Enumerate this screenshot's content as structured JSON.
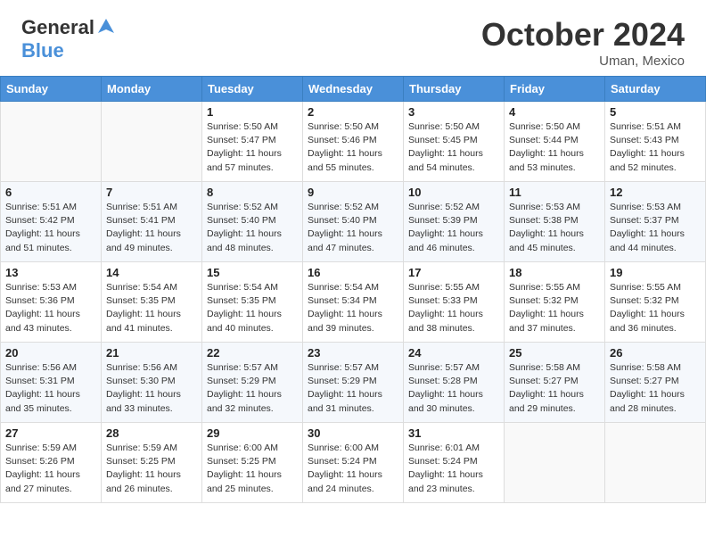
{
  "header": {
    "logo_line1": "General",
    "logo_line2": "Blue",
    "month": "October 2024",
    "location": "Uman, Mexico"
  },
  "weekdays": [
    "Sunday",
    "Monday",
    "Tuesday",
    "Wednesday",
    "Thursday",
    "Friday",
    "Saturday"
  ],
  "weeks": [
    [
      {
        "day": "",
        "info": ""
      },
      {
        "day": "",
        "info": ""
      },
      {
        "day": "1",
        "info": "Sunrise: 5:50 AM\nSunset: 5:47 PM\nDaylight: 11 hours and 57 minutes."
      },
      {
        "day": "2",
        "info": "Sunrise: 5:50 AM\nSunset: 5:46 PM\nDaylight: 11 hours and 55 minutes."
      },
      {
        "day": "3",
        "info": "Sunrise: 5:50 AM\nSunset: 5:45 PM\nDaylight: 11 hours and 54 minutes."
      },
      {
        "day": "4",
        "info": "Sunrise: 5:50 AM\nSunset: 5:44 PM\nDaylight: 11 hours and 53 minutes."
      },
      {
        "day": "5",
        "info": "Sunrise: 5:51 AM\nSunset: 5:43 PM\nDaylight: 11 hours and 52 minutes."
      }
    ],
    [
      {
        "day": "6",
        "info": "Sunrise: 5:51 AM\nSunset: 5:42 PM\nDaylight: 11 hours and 51 minutes."
      },
      {
        "day": "7",
        "info": "Sunrise: 5:51 AM\nSunset: 5:41 PM\nDaylight: 11 hours and 49 minutes."
      },
      {
        "day": "8",
        "info": "Sunrise: 5:52 AM\nSunset: 5:40 PM\nDaylight: 11 hours and 48 minutes."
      },
      {
        "day": "9",
        "info": "Sunrise: 5:52 AM\nSunset: 5:40 PM\nDaylight: 11 hours and 47 minutes."
      },
      {
        "day": "10",
        "info": "Sunrise: 5:52 AM\nSunset: 5:39 PM\nDaylight: 11 hours and 46 minutes."
      },
      {
        "day": "11",
        "info": "Sunrise: 5:53 AM\nSunset: 5:38 PM\nDaylight: 11 hours and 45 minutes."
      },
      {
        "day": "12",
        "info": "Sunrise: 5:53 AM\nSunset: 5:37 PM\nDaylight: 11 hours and 44 minutes."
      }
    ],
    [
      {
        "day": "13",
        "info": "Sunrise: 5:53 AM\nSunset: 5:36 PM\nDaylight: 11 hours and 43 minutes."
      },
      {
        "day": "14",
        "info": "Sunrise: 5:54 AM\nSunset: 5:35 PM\nDaylight: 11 hours and 41 minutes."
      },
      {
        "day": "15",
        "info": "Sunrise: 5:54 AM\nSunset: 5:35 PM\nDaylight: 11 hours and 40 minutes."
      },
      {
        "day": "16",
        "info": "Sunrise: 5:54 AM\nSunset: 5:34 PM\nDaylight: 11 hours and 39 minutes."
      },
      {
        "day": "17",
        "info": "Sunrise: 5:55 AM\nSunset: 5:33 PM\nDaylight: 11 hours and 38 minutes."
      },
      {
        "day": "18",
        "info": "Sunrise: 5:55 AM\nSunset: 5:32 PM\nDaylight: 11 hours and 37 minutes."
      },
      {
        "day": "19",
        "info": "Sunrise: 5:55 AM\nSunset: 5:32 PM\nDaylight: 11 hours and 36 minutes."
      }
    ],
    [
      {
        "day": "20",
        "info": "Sunrise: 5:56 AM\nSunset: 5:31 PM\nDaylight: 11 hours and 35 minutes."
      },
      {
        "day": "21",
        "info": "Sunrise: 5:56 AM\nSunset: 5:30 PM\nDaylight: 11 hours and 33 minutes."
      },
      {
        "day": "22",
        "info": "Sunrise: 5:57 AM\nSunset: 5:29 PM\nDaylight: 11 hours and 32 minutes."
      },
      {
        "day": "23",
        "info": "Sunrise: 5:57 AM\nSunset: 5:29 PM\nDaylight: 11 hours and 31 minutes."
      },
      {
        "day": "24",
        "info": "Sunrise: 5:57 AM\nSunset: 5:28 PM\nDaylight: 11 hours and 30 minutes."
      },
      {
        "day": "25",
        "info": "Sunrise: 5:58 AM\nSunset: 5:27 PM\nDaylight: 11 hours and 29 minutes."
      },
      {
        "day": "26",
        "info": "Sunrise: 5:58 AM\nSunset: 5:27 PM\nDaylight: 11 hours and 28 minutes."
      }
    ],
    [
      {
        "day": "27",
        "info": "Sunrise: 5:59 AM\nSunset: 5:26 PM\nDaylight: 11 hours and 27 minutes."
      },
      {
        "day": "28",
        "info": "Sunrise: 5:59 AM\nSunset: 5:25 PM\nDaylight: 11 hours and 26 minutes."
      },
      {
        "day": "29",
        "info": "Sunrise: 6:00 AM\nSunset: 5:25 PM\nDaylight: 11 hours and 25 minutes."
      },
      {
        "day": "30",
        "info": "Sunrise: 6:00 AM\nSunset: 5:24 PM\nDaylight: 11 hours and 24 minutes."
      },
      {
        "day": "31",
        "info": "Sunrise: 6:01 AM\nSunset: 5:24 PM\nDaylight: 11 hours and 23 minutes."
      },
      {
        "day": "",
        "info": ""
      },
      {
        "day": "",
        "info": ""
      }
    ]
  ]
}
